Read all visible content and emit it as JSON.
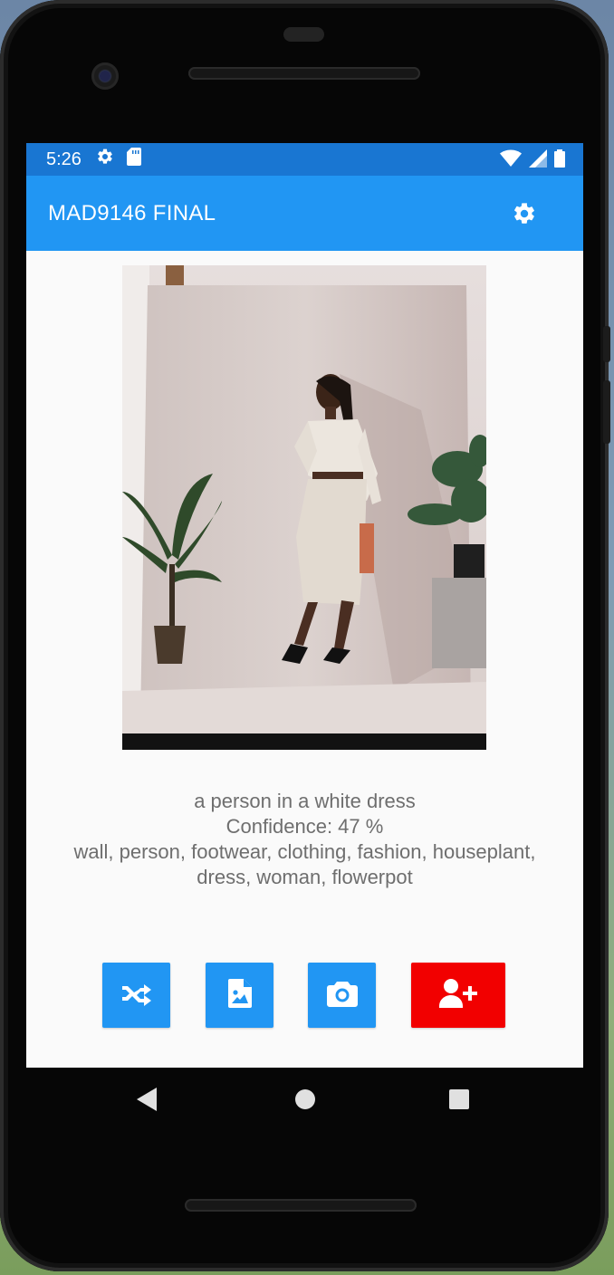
{
  "status_bar": {
    "time": "5:26",
    "left_icons": [
      "gear-icon",
      "sd-card-icon"
    ],
    "right_icons": [
      "wifi-icon",
      "cellular-signal-icon",
      "battery-icon"
    ]
  },
  "app_bar": {
    "title": "MAD9146 FINAL",
    "action_icon": "settings-icon"
  },
  "image": {
    "description_only": true
  },
  "caption": {
    "label": "a person in a white dress",
    "confidence": "Confidence: 47 %",
    "tags": "wall, person, footwear, clothing, fashion, houseplant, dress, woman, flowerpot"
  },
  "buttons": [
    {
      "icon": "shuffle-icon",
      "color": "#2196f3"
    },
    {
      "icon": "image-file-icon",
      "color": "#2196f3"
    },
    {
      "icon": "camera-icon",
      "color": "#2196f3"
    },
    {
      "icon": "add-user-icon",
      "color": "#f20000"
    }
  ],
  "nav_bar": {
    "items": [
      "back-icon",
      "home-icon",
      "recents-icon"
    ]
  },
  "colors": {
    "status_bar": "#1976d2",
    "app_bar": "#2196f3",
    "accent_red": "#f20000",
    "caption_text": "#6e6e6e"
  }
}
